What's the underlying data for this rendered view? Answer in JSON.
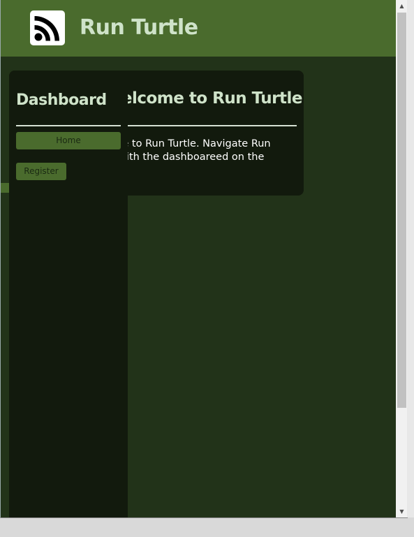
{
  "header": {
    "title": "Run Turtle",
    "logo_icon": "rss-icon"
  },
  "sidebar": {
    "title": "Dashboard",
    "items": [
      {
        "label": "Home"
      },
      {
        "label": "Register"
      }
    ]
  },
  "main": {
    "title": "Welcome to Run Turtle",
    "text_line1": "Welcome to Run Turtle. Navigate Run",
    "text_line2": "Turtle with the dashboareed on the"
  },
  "colors": {
    "header_bg": "#4a6b2d",
    "page_bg": "#223319",
    "card_bg": "#121a0d",
    "title_color": "#cfe3c9"
  }
}
